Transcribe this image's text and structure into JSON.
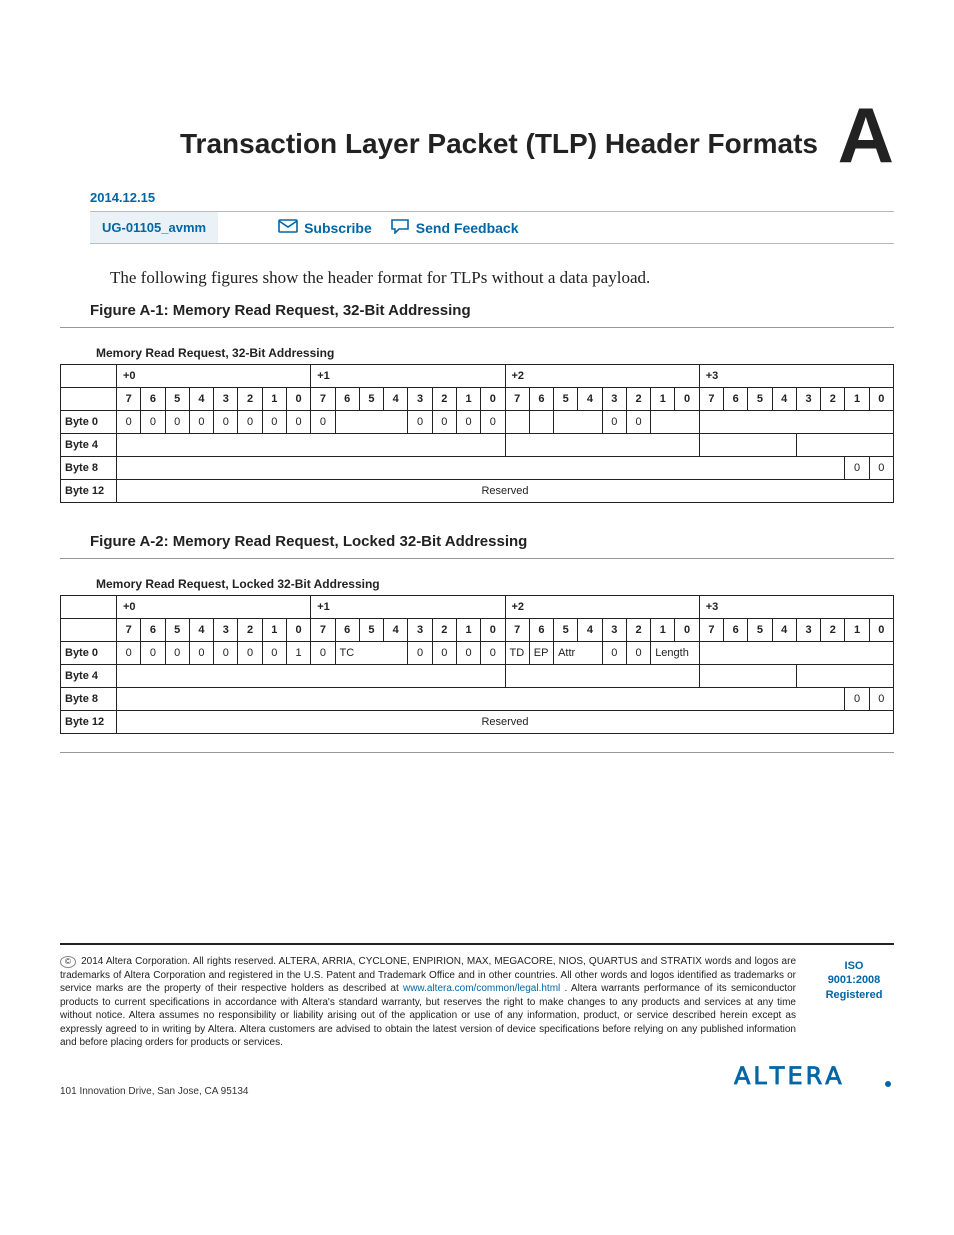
{
  "header": {
    "title": "Transaction Layer Packet (TLP) Header Formats",
    "appendix_letter": "A",
    "date": "2014.12.15",
    "doc_id": "UG-01105_avmm",
    "subscribe": "Subscribe",
    "feedback": "Send Feedback"
  },
  "intro": "The following figures show the header format for TLPs without a data payload.",
  "fig1": {
    "label": "Figure A-1: Memory Read Request, 32-Bit Addressing",
    "caption": "Memory Read Request, 32-Bit Addressing",
    "groups": [
      "+0",
      "+1",
      "+2",
      "+3"
    ],
    "bits": [
      "7",
      "6",
      "5",
      "4",
      "3",
      "2",
      "1",
      "0"
    ],
    "rows": {
      "r0": [
        "Byte 0",
        "0",
        "0",
        "0",
        "0",
        "0",
        "0",
        "0",
        "0",
        "0",
        "",
        "",
        "0",
        "0",
        "0",
        "0",
        "",
        "",
        "",
        "0",
        "0",
        "",
        "",
        "",
        "",
        "",
        "",
        "",
        ""
      ],
      "r1": [
        "Byte 4"
      ],
      "r2": [
        "Byte 8",
        "0",
        "0"
      ],
      "r3": [
        "Byte 12",
        "Reserved"
      ]
    }
  },
  "fig2": {
    "label": "Figure A-2: Memory Read Request, Locked 32-Bit Addressing",
    "caption": "Memory Read Request, Locked 32-Bit Addressing",
    "groups": [
      "+0",
      "+1",
      "+2",
      "+3"
    ],
    "bits": [
      "7",
      "6",
      "5",
      "4",
      "3",
      "2",
      "1",
      "0"
    ],
    "rows": {
      "r0": [
        "Byte 0",
        "0",
        "0",
        "0",
        "0",
        "0",
        "0",
        "0",
        "1",
        "0",
        "TC",
        "0",
        "0",
        "0",
        "0",
        "TD",
        "EP",
        "Attr",
        "0",
        "0",
        "Length"
      ],
      "r1": [
        "Byte 4"
      ],
      "r2": [
        "Byte 8",
        "0",
        "0"
      ],
      "r3": [
        "Byte 12",
        "Reserved"
      ]
    }
  },
  "footer": {
    "copyright": "2014 Altera Corporation. All rights reserved. ALTERA, ARRIA, CYCLONE, ENPIRION, MAX, MEGACORE, NIOS, QUARTUS and STRATIX words and logos are trademarks of Altera Corporation and registered in the U.S. Patent and Trademark Office and in other countries. All other words and logos identified as trademarks or service marks are the property of their respective holders as described at ",
    "legal_link": "www.altera.com/common/legal.html",
    "copyright2": ". Altera warrants performance of its semiconductor products to current specifications in accordance with Altera's standard warranty, but reserves the right to make changes to any products and services at any time without notice. Altera assumes no responsibility or liability arising out of the application or use of any information, product, or service described herein except as expressly agreed to in writing by Altera. Altera customers are advised to obtain the latest version of device specifications before relying on any published information and before placing orders for products or services.",
    "iso": [
      "ISO",
      "9001:2008",
      "Registered"
    ],
    "address": "101 Innovation Drive, San Jose, CA 95134",
    "logo_text": "ALTERA"
  }
}
